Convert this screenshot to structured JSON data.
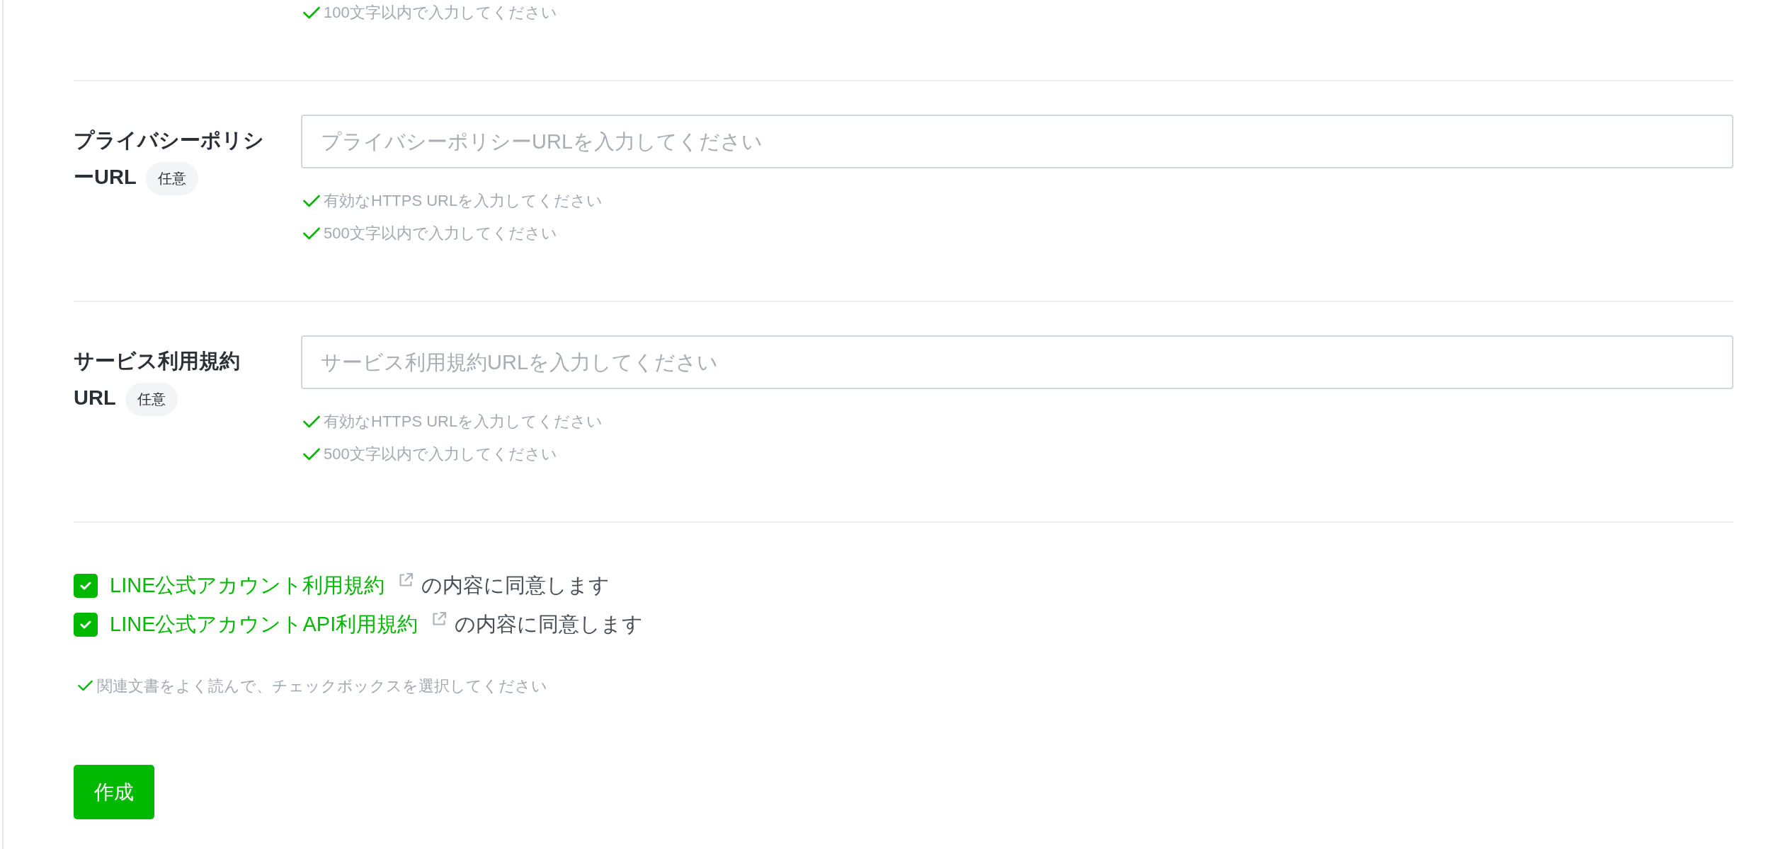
{
  "top_hint": {
    "text": "100文字以内で入力してください",
    "met": true
  },
  "fields": [
    {
      "label": "プライバシーポリシーURL",
      "badge": "任意",
      "placeholder": "プライバシーポリシーURLを入力してください",
      "hints": [
        {
          "text": "有効なHTTPS URLを入力してください",
          "met": true
        },
        {
          "text": "500文字以内で入力してください",
          "met": true
        }
      ]
    },
    {
      "label": "サービス利用規約URL",
      "badge": "任意",
      "placeholder": "サービス利用規約URLを入力してください",
      "hints": [
        {
          "text": "有効なHTTPS URLを入力してください",
          "met": true
        },
        {
          "text": "500文字以内で入力してください",
          "met": true
        }
      ]
    }
  ],
  "agreements": [
    {
      "link": "LINE公式アカウント利用規約",
      "text": "の内容に同意します",
      "checked": true
    },
    {
      "link": "LINE公式アカウントAPI利用規約",
      "text": "の内容に同意します",
      "checked": true
    }
  ],
  "agreement_hint": {
    "text": "関連文書をよく読んで、チェックボックスを選択してください",
    "met": true
  },
  "submit_button": {
    "label": "作成"
  }
}
